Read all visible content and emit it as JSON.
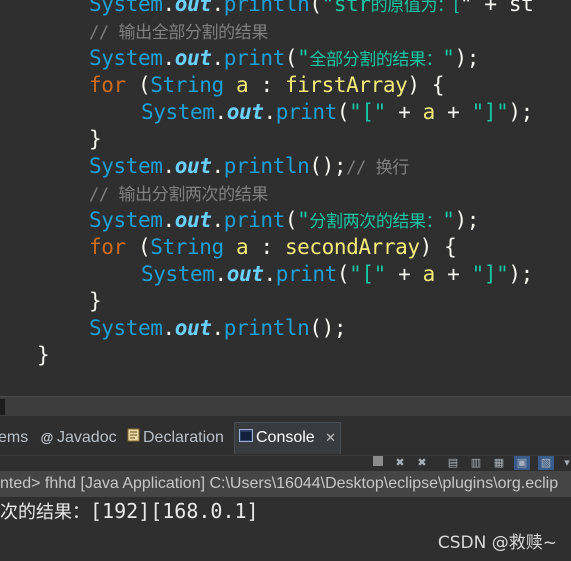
{
  "editor": {
    "lines": [
      {
        "indent": "    ",
        "parts": [
          {
            "t": "System",
            "c": "cls"
          },
          {
            "t": ".",
            "c": "pun"
          },
          {
            "t": "out",
            "c": "fld"
          },
          {
            "t": ".",
            "c": "pun"
          },
          {
            "t": "println",
            "c": "mth"
          },
          {
            "t": "(",
            "c": "pun"
          },
          {
            "t": "\"",
            "c": "str"
          },
          {
            "t": "str",
            "c": "str"
          },
          {
            "t": "的原值为：[",
            "c": "str cjk"
          },
          {
            "t": "\" + st",
            "c": "pun"
          }
        ]
      },
      {
        "indent": "    ",
        "parts": [
          {
            "t": "// ",
            "c": "cmt"
          },
          {
            "t": "输出全部分割的结果",
            "c": "cmt cjk"
          }
        ]
      },
      {
        "indent": "    ",
        "parts": [
          {
            "t": "System",
            "c": "cls"
          },
          {
            "t": ".",
            "c": "pun"
          },
          {
            "t": "out",
            "c": "fld"
          },
          {
            "t": ".",
            "c": "pun"
          },
          {
            "t": "print",
            "c": "mth"
          },
          {
            "t": "(",
            "c": "pun"
          },
          {
            "t": "\"",
            "c": "str"
          },
          {
            "t": "全部分割的结果：",
            "c": "str cjk"
          },
          {
            "t": "\"",
            "c": "str"
          },
          {
            "t": ");",
            "c": "pun"
          }
        ]
      },
      {
        "indent": "    ",
        "parts": [
          {
            "t": "for",
            "c": "kw"
          },
          {
            "t": " (",
            "c": "pun"
          },
          {
            "t": "String",
            "c": "typ"
          },
          {
            "t": " a",
            "c": "var"
          },
          {
            "t": " : ",
            "c": "pun"
          },
          {
            "t": "firstArray",
            "c": "var"
          },
          {
            "t": ") {",
            "c": "pun"
          }
        ]
      },
      {
        "indent": "        ",
        "parts": [
          {
            "t": "System",
            "c": "cls"
          },
          {
            "t": ".",
            "c": "pun"
          },
          {
            "t": "out",
            "c": "fld"
          },
          {
            "t": ".",
            "c": "pun"
          },
          {
            "t": "print",
            "c": "mth"
          },
          {
            "t": "(",
            "c": "pun"
          },
          {
            "t": "\"[\"",
            "c": "str"
          },
          {
            "t": " + ",
            "c": "pun"
          },
          {
            "t": "a",
            "c": "var"
          },
          {
            "t": " + ",
            "c": "pun"
          },
          {
            "t": "\"]\"",
            "c": "str"
          },
          {
            "t": ");",
            "c": "pun"
          }
        ]
      },
      {
        "indent": "    ",
        "parts": [
          {
            "t": "}",
            "c": "pun"
          }
        ]
      },
      {
        "indent": "    ",
        "parts": [
          {
            "t": "System",
            "c": "cls"
          },
          {
            "t": ".",
            "c": "pun"
          },
          {
            "t": "out",
            "c": "fld"
          },
          {
            "t": ".",
            "c": "pun"
          },
          {
            "t": "println",
            "c": "mth"
          },
          {
            "t": "();",
            "c": "pun"
          },
          {
            "t": "// ",
            "c": "cmt"
          },
          {
            "t": "换行",
            "c": "cmt cjk"
          }
        ]
      },
      {
        "indent": "    ",
        "parts": [
          {
            "t": "// ",
            "c": "cmt"
          },
          {
            "t": "输出分割两次的结果",
            "c": "cmt cjk"
          }
        ]
      },
      {
        "indent": "    ",
        "parts": [
          {
            "t": "System",
            "c": "cls"
          },
          {
            "t": ".",
            "c": "pun"
          },
          {
            "t": "out",
            "c": "fld"
          },
          {
            "t": ".",
            "c": "pun"
          },
          {
            "t": "print",
            "c": "mth"
          },
          {
            "t": "(",
            "c": "pun"
          },
          {
            "t": "\"",
            "c": "str"
          },
          {
            "t": "分割两次的结果：",
            "c": "str cjk"
          },
          {
            "t": "\"",
            "c": "str"
          },
          {
            "t": ");",
            "c": "pun"
          }
        ]
      },
      {
        "indent": "    ",
        "parts": [
          {
            "t": "for",
            "c": "kw"
          },
          {
            "t": " (",
            "c": "pun"
          },
          {
            "t": "String",
            "c": "typ"
          },
          {
            "t": " a",
            "c": "var"
          },
          {
            "t": " : ",
            "c": "pun"
          },
          {
            "t": "secondArray",
            "c": "var"
          },
          {
            "t": ") {",
            "c": "pun"
          }
        ]
      },
      {
        "indent": "        ",
        "parts": [
          {
            "t": "System",
            "c": "cls"
          },
          {
            "t": ".",
            "c": "pun"
          },
          {
            "t": "out",
            "c": "fld"
          },
          {
            "t": ".",
            "c": "pun"
          },
          {
            "t": "print",
            "c": "mth"
          },
          {
            "t": "(",
            "c": "pun"
          },
          {
            "t": "\"[\"",
            "c": "str"
          },
          {
            "t": " + ",
            "c": "pun"
          },
          {
            "t": "a",
            "c": "var"
          },
          {
            "t": " + ",
            "c": "pun"
          },
          {
            "t": "\"]\"",
            "c": "str"
          },
          {
            "t": ");",
            "c": "pun"
          }
        ]
      },
      {
        "indent": "    ",
        "parts": [
          {
            "t": "}",
            "c": "pun"
          }
        ]
      },
      {
        "indent": "    ",
        "parts": [
          {
            "t": "System",
            "c": "cls"
          },
          {
            "t": ".",
            "c": "pun"
          },
          {
            "t": "out",
            "c": "fld"
          },
          {
            "t": ".",
            "c": "pun"
          },
          {
            "t": "println",
            "c": "mth"
          },
          {
            "t": "();",
            "c": "pun"
          }
        ]
      },
      {
        "indent": "",
        "parts": [
          {
            "t": "}",
            "c": "pun"
          }
        ]
      }
    ]
  },
  "tabs": {
    "problems_label": "ems",
    "javadoc_icon": "at-icon",
    "javadoc_label": "Javadoc",
    "declaration_icon": "declaration-icon",
    "declaration_label": "Declaration",
    "console_icon": "console-icon",
    "console_label": "Console",
    "close_glyph": "✕"
  },
  "console": {
    "header": "nted> fhhd [Java Application] C:\\Users\\16044\\Desktop\\eclipse\\plugins\\org.eclip",
    "output_cjk": "次的结果：",
    "output_values": "[192][168.0.1]"
  },
  "watermark": "CSDN @救赎~",
  "colors": {
    "background": "#2f2f2f",
    "class": "#1ea0d6",
    "field": "#6ad1ff",
    "string": "#17c6a3",
    "keyword": "#cc6c1d",
    "variable": "#f3ec79",
    "comment": "#808080"
  }
}
